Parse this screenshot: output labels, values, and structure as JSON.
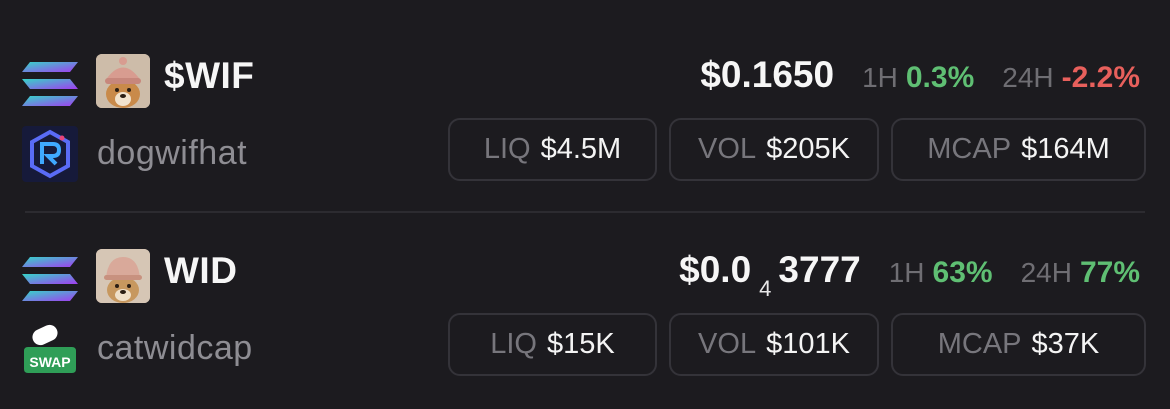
{
  "colors": {
    "background": "#1c1b1f",
    "positive": "#5fbf73",
    "negative": "#e8605c",
    "muted": "#6f6e73",
    "border": "#343339"
  },
  "tokens": [
    {
      "chain_icon": "solana-icon",
      "avatar": "dog-with-knit-hat-avatar",
      "symbol": "$WIF",
      "name": "dogwifhat",
      "dex_icon": "raydium-icon",
      "price": {
        "prefix": "$0.1650",
        "sub": "",
        "suffix": ""
      },
      "change_1h_label": "1H",
      "change_1h": "0.3%",
      "change_1h_direction": "up",
      "change_24h_label": "24H",
      "change_24h": "-2.2%",
      "change_24h_direction": "down",
      "liq_label": "LIQ",
      "liq": "$4.5M",
      "vol_label": "VOL",
      "vol": "$205K",
      "mcap_label": "MCAP",
      "mcap": "$164M"
    },
    {
      "chain_icon": "solana-icon",
      "avatar": "dog-with-cap-avatar",
      "symbol": "WID",
      "name": "catwidcap",
      "dex_icon": "swap-pill-icon",
      "dex_icon_text": "SWAP",
      "price": {
        "prefix": "$0.0",
        "sub": "4",
        "suffix": "3777"
      },
      "change_1h_label": "1H",
      "change_1h": "63%",
      "change_1h_direction": "up",
      "change_24h_label": "24H",
      "change_24h": "77%",
      "change_24h_direction": "up",
      "liq_label": "LIQ",
      "liq": "$15K",
      "vol_label": "VOL",
      "vol": "$101K",
      "mcap_label": "MCAP",
      "mcap": "$37K"
    }
  ]
}
